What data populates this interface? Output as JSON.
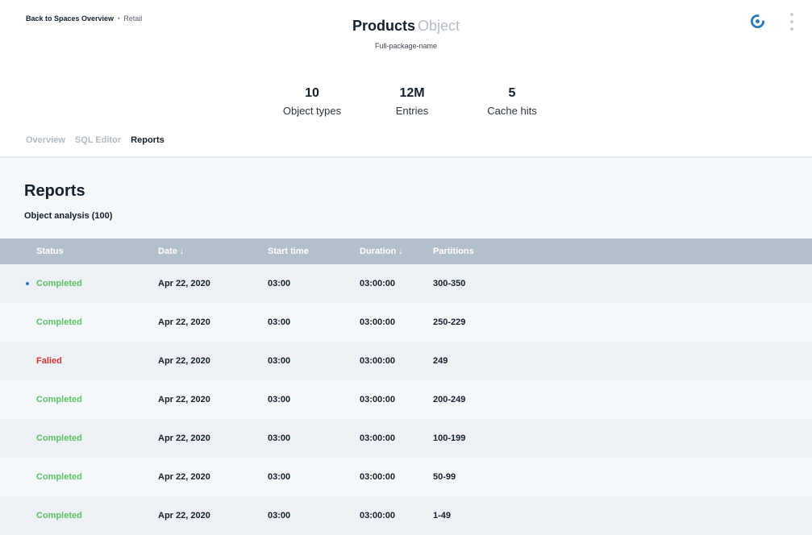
{
  "breadcrumb": {
    "back": "Back to Spaces Overview",
    "separator": "•",
    "current": "Retail"
  },
  "header": {
    "title_main": "Products",
    "title_sub": "Object",
    "subtitle": "Full-package-name"
  },
  "stats": [
    {
      "value": "10",
      "label": "Object types"
    },
    {
      "value": "12M",
      "label": "Entries"
    },
    {
      "value": "5",
      "label": "Cache hits"
    }
  ],
  "tabs": [
    {
      "label": "Overview",
      "active": false
    },
    {
      "label": "SQL Editor",
      "active": false
    },
    {
      "label": "Reports",
      "active": true
    }
  ],
  "reports": {
    "title": "Reports",
    "subtitle": "Object analysis (100)",
    "columns": {
      "status": "Status",
      "date": "Date ↓",
      "start": "Start time",
      "duration": "Duration ↓",
      "partitions": "Partitions"
    },
    "rows": [
      {
        "status": "Completed",
        "date": "Apr 22, 2020",
        "start": "03:00",
        "duration": "03:00:00",
        "partitions": "300-350"
      },
      {
        "status": "Completed",
        "date": "Apr 22, 2020",
        "start": "03:00",
        "duration": "03:00:00",
        "partitions": "250-229"
      },
      {
        "status": "Falied",
        "date": "Apr 22, 2020",
        "start": "03:00",
        "duration": "03:00:00",
        "partitions": "249"
      },
      {
        "status": "Completed",
        "date": "Apr 22, 2020",
        "start": "03:00",
        "duration": "03:00:00",
        "partitions": "200-249"
      },
      {
        "status": "Completed",
        "date": "Apr 22, 2020",
        "start": "03:00",
        "duration": "03:00:00",
        "partitions": "100-199"
      },
      {
        "status": "Completed",
        "date": "Apr 22, 2020",
        "start": "03:00",
        "duration": "03:00:00",
        "partitions": "50-99"
      },
      {
        "status": "Completed",
        "date": "Apr 22, 2020",
        "start": "03:00",
        "duration": "03:00:00",
        "partitions": "1-49"
      }
    ]
  },
  "icons": {
    "top_right": "app-logo-icon",
    "menu": "more-vertical-icon",
    "row_indicator": "selected-dot-icon"
  },
  "colors": {
    "completed": "#5dc264",
    "failed": "#d2342f",
    "accent": "#2a7cb8",
    "header_bar": "#b3c0cc"
  }
}
